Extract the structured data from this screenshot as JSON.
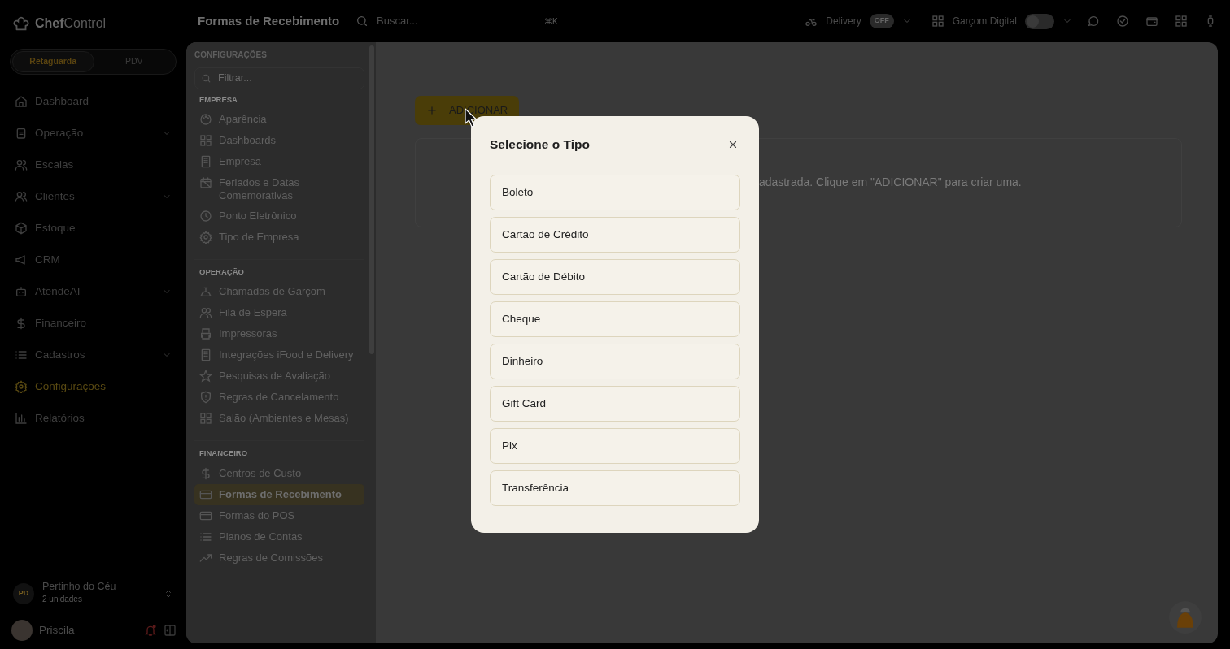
{
  "brand": {
    "bold": "Chef",
    "light": "Control"
  },
  "mode_switch": [
    {
      "label": "Retaguarda",
      "selected": true
    },
    {
      "label": "PDV",
      "selected": false
    }
  ],
  "sidebar": {
    "items": [
      {
        "label": "Dashboard",
        "has_children": false,
        "selected": false
      },
      {
        "label": "Operação",
        "has_children": true,
        "selected": false
      },
      {
        "label": "Escalas",
        "has_children": false,
        "selected": false
      },
      {
        "label": "Clientes",
        "has_children": true,
        "selected": false
      },
      {
        "label": "Estoque",
        "has_children": false,
        "selected": false
      },
      {
        "label": "CRM",
        "has_children": false,
        "selected": false
      },
      {
        "label": "AtendeAI",
        "has_children": true,
        "selected": false
      },
      {
        "label": "Financeiro",
        "has_children": false,
        "selected": false
      },
      {
        "label": "Cadastros",
        "has_children": true,
        "selected": false
      },
      {
        "label": "Configurações",
        "has_children": false,
        "selected": true
      },
      {
        "label": "Relatórios",
        "has_children": false,
        "selected": false
      }
    ],
    "company": {
      "initials": "PD",
      "name": "Pertinho do Céu",
      "units": "2 unidades"
    },
    "user": {
      "name": "Priscila"
    }
  },
  "topbar": {
    "title": "Formas de Recebimento",
    "search_placeholder": "Buscar...",
    "shortcut": "⌘K",
    "delivery": {
      "label": "Delivery",
      "badge": "OFF"
    },
    "waiter": {
      "label": "Garçom Digital",
      "on": false
    }
  },
  "settings_panel": {
    "title": "CONFIGURAÇÕES",
    "filter_placeholder": "Filtrar...",
    "sections": [
      {
        "title": "EMPRESA",
        "items": [
          {
            "label": "Aparência",
            "selected": false
          },
          {
            "label": "Dashboards",
            "selected": false
          },
          {
            "label": "Empresa",
            "selected": false
          },
          {
            "label": "Feriados e Datas Comemorativas",
            "selected": false
          },
          {
            "label": "Ponto Eletrônico",
            "selected": false
          },
          {
            "label": "Tipo de Empresa",
            "selected": false
          }
        ]
      },
      {
        "title": "OPERAÇÃO",
        "items": [
          {
            "label": "Chamadas de Garçom",
            "selected": false
          },
          {
            "label": "Fila de Espera",
            "selected": false
          },
          {
            "label": "Impressoras",
            "selected": false
          },
          {
            "label": "Integrações iFood e Delivery",
            "selected": false
          },
          {
            "label": "Pesquisas de Avaliação",
            "selected": false
          },
          {
            "label": "Regras de Cancelamento",
            "selected": false
          },
          {
            "label": "Salão (Ambientes e Mesas)",
            "selected": false
          }
        ]
      },
      {
        "title": "FINANCEIRO",
        "items": [
          {
            "label": "Centros de Custo",
            "selected": false
          },
          {
            "label": "Formas de Recebimento",
            "selected": true
          },
          {
            "label": "Formas do POS",
            "selected": false
          },
          {
            "label": "Planos de Contas",
            "selected": false
          },
          {
            "label": "Regras de Comissões",
            "selected": false
          }
        ]
      }
    ]
  },
  "main": {
    "add_button": "ADICIONAR",
    "empty_message": "adastrada. Clique em \"ADICIONAR\" para criar uma."
  },
  "modal": {
    "title": "Selecione o Tipo",
    "options": [
      "Boleto",
      "Cartão de Crédito",
      "Cartão de Débito",
      "Cheque",
      "Dinheiro",
      "Gift Card",
      "Pix",
      "Transferência"
    ]
  }
}
